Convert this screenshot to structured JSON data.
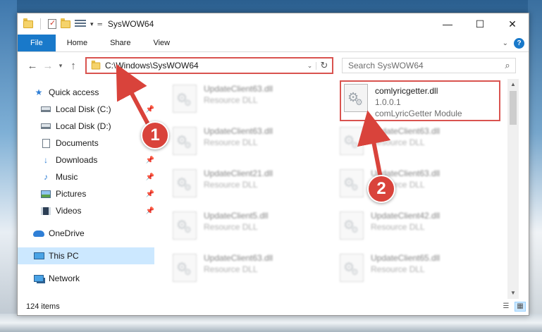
{
  "window": {
    "title": "SysWOW64",
    "controls": {
      "minimize": "—",
      "maximize": "☐",
      "close": "✕"
    }
  },
  "ribbon": {
    "tabs": [
      "File",
      "Home",
      "Share",
      "View"
    ],
    "help": "?"
  },
  "address": {
    "path": "C:\\Windows\\SysWOW64",
    "search_placeholder": "Search SysWOW64"
  },
  "sidebar": {
    "items": [
      {
        "label": "Quick access",
        "icon": "star-icon",
        "pinned": false
      },
      {
        "label": "Local Disk (C:)",
        "icon": "disk-icon",
        "pinned": true
      },
      {
        "label": "Local Disk (D:)",
        "icon": "disk-icon",
        "pinned": false
      },
      {
        "label": "Documents",
        "icon": "documents-icon",
        "pinned": true
      },
      {
        "label": "Downloads",
        "icon": "download-icon",
        "pinned": true
      },
      {
        "label": "Music",
        "icon": "music-icon",
        "pinned": true
      },
      {
        "label": "Pictures",
        "icon": "pictures-icon",
        "pinned": true
      },
      {
        "label": "Videos",
        "icon": "videos-icon",
        "pinned": true
      },
      {
        "label": "OneDrive",
        "icon": "onedrive-icon",
        "pinned": false
      },
      {
        "label": "This PC",
        "icon": "this-pc-icon",
        "pinned": false,
        "selected": true
      },
      {
        "label": "Network",
        "icon": "network-icon",
        "pinned": false
      }
    ]
  },
  "files": [
    {
      "name": "UpdateClient63.dll",
      "meta": "Resource DLL"
    },
    {
      "name": "comlyricgetter.dll",
      "meta": "1.0.0.1",
      "meta2": "comLyricGetter Module"
    },
    {
      "name": "UpdateClient63.dll",
      "meta": "Resource DLL"
    },
    {
      "name": "UpdateClient63.dll",
      "meta": "Resource DLL"
    },
    {
      "name": "UpdateClient21.dll",
      "meta": "Resource DLL"
    },
    {
      "name": "UpdateClient63.dll",
      "meta": "Resource DLL"
    },
    {
      "name": "UpdateClient5.dll",
      "meta": "Resource DLL"
    },
    {
      "name": "UpdateClient42.dll",
      "meta": "Resource DLL"
    },
    {
      "name": "UpdateClient63.dll",
      "meta": "Resource DLL"
    },
    {
      "name": "UpdateClient65.dll",
      "meta": "Resource DLL"
    }
  ],
  "status": {
    "count": "124 items"
  },
  "callouts": {
    "one": "1",
    "two": "2"
  },
  "colors": {
    "accent": "#1979ca",
    "highlight": "#d9534f",
    "selection": "#cce8ff"
  }
}
